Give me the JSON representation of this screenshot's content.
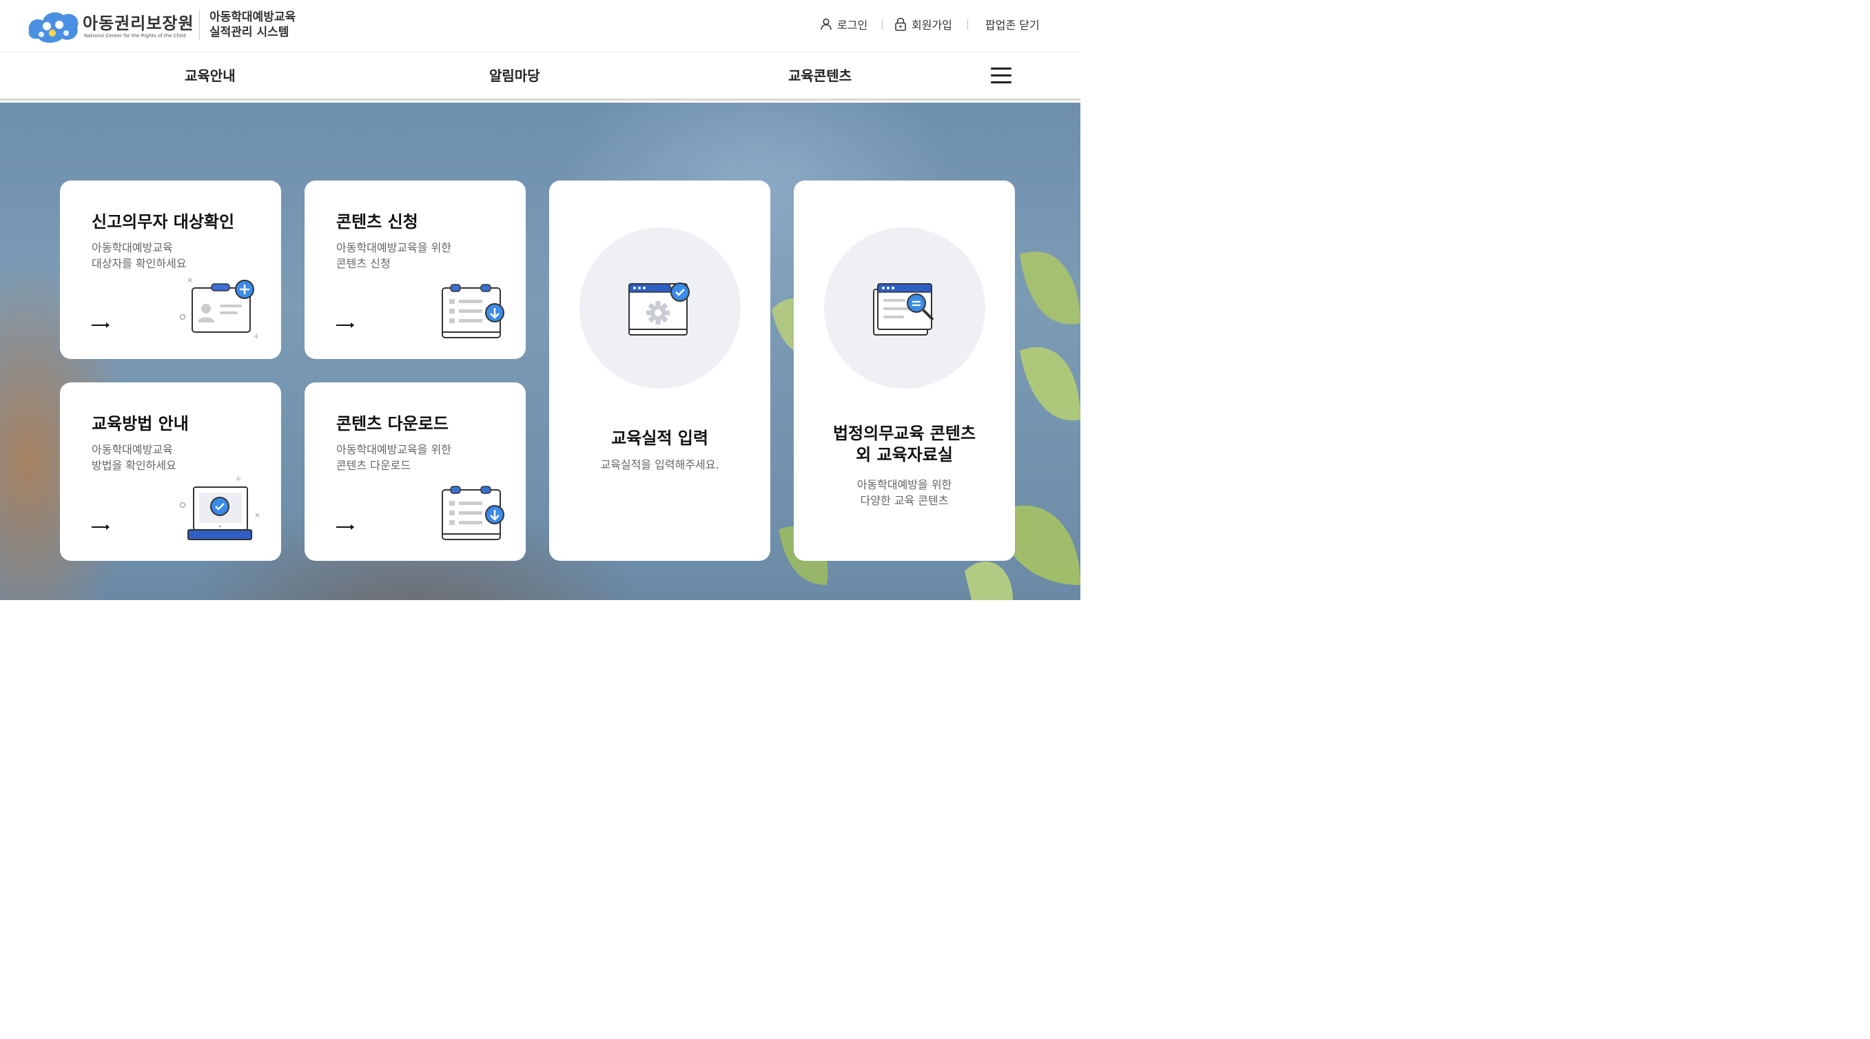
{
  "header": {
    "logo_kr": "아동권리보장원",
    "logo_en": "National Center for the Rights of the Child",
    "system_title_line1": "아동학대예방교육",
    "system_title_line2": "실적관리 시스템",
    "login_label": "로그인",
    "join_label": "회원가입",
    "popup_close_label": "팝업존 닫기"
  },
  "nav": {
    "items": [
      {
        "label": "교육안내"
      },
      {
        "label": "알림마당"
      },
      {
        "label": "교육콘텐츠"
      }
    ],
    "menu_icon": "hamburger-icon"
  },
  "cards": [
    {
      "title": "신고의무자 대상확인",
      "desc_line1": "아동학대예방교육",
      "desc_line2": "대상자를 확인하세요",
      "icon": "id-card-add-icon"
    },
    {
      "title": "콘텐츠 신청",
      "desc_line1": "아동학대예방교육을 위한",
      "desc_line2": "콘텐츠 신청",
      "icon": "calendar-download-icon"
    },
    {
      "title": "교육방법 안내",
      "desc_line1": "아동학대예방교육",
      "desc_line2": "방법을 확인하세요",
      "icon": "laptop-check-icon"
    },
    {
      "title": "콘텐츠 다운로드",
      "desc_line1": "아동학대예방교육을 위한",
      "desc_line2": "콘텐츠 다운로드",
      "icon": "calendar-download-icon"
    },
    {
      "title": "교육실적 입력",
      "desc_line1": "교육실적을 입력해주세요.",
      "icon": "settings-window-icon"
    },
    {
      "title_line1": "법정의무교육 콘텐츠",
      "title_line2": "외 교육자료실",
      "desc_line1": "아동학대예방을 위한",
      "desc_line2": "다양한 교육 콘텐츠",
      "icon": "document-search-icon"
    }
  ],
  "colors": {
    "accent_blue": "#3b8be8",
    "dark_blue": "#2f5fc4",
    "card_bg": "#ffffff",
    "circle_bg": "#eef0f5"
  }
}
